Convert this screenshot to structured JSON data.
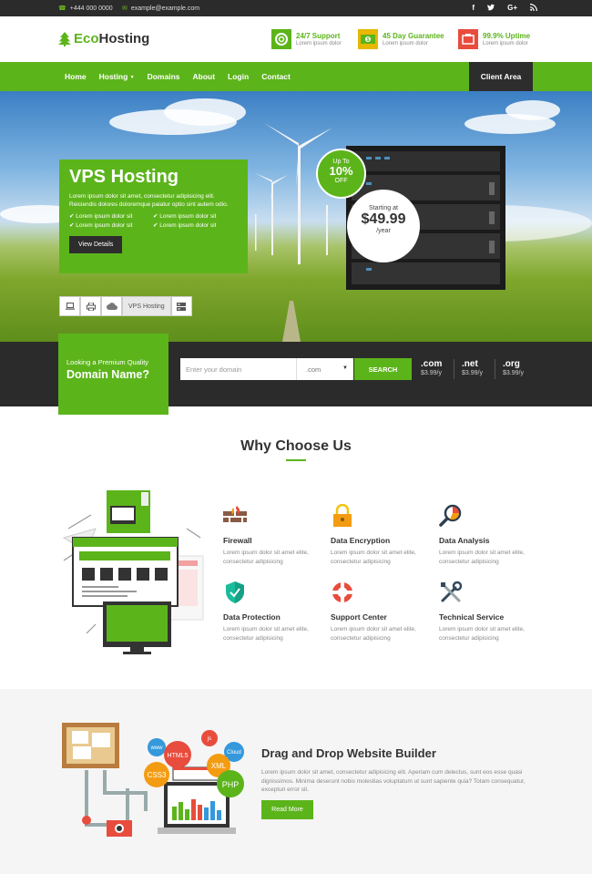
{
  "topbar": {
    "phone": "+444 000 0000",
    "email": "example@example.com",
    "social": [
      "f",
      "t",
      "G+",
      "rss"
    ]
  },
  "header": {
    "logo_part1": "Eco",
    "logo_part2": "Hosting",
    "features": [
      {
        "title": "24/7 Support",
        "sub": "Lorem ipsum dolor",
        "icon": "support-icon",
        "color": "#5cb41b"
      },
      {
        "title": "45 Day Guarantee",
        "sub": "Lorem ipsum dolor",
        "icon": "money-icon",
        "color": "#e6b800"
      },
      {
        "title": "99.9% Uptime",
        "sub": "Lorem ipsum dolor",
        "icon": "uptime-icon",
        "color": "#e84c3d"
      }
    ]
  },
  "nav": {
    "items": [
      "Home",
      "Hosting",
      "Domains",
      "About",
      "Login",
      "Contact"
    ],
    "client_area": "Client Area"
  },
  "hero": {
    "title": "VPS Hosting",
    "text": "Lorem ipsum dolor sit amet, consectetur adipisicing elit. Reiciendis dolores doloremque paiatur optio sint autem odio.",
    "checks": [
      "Lorem ipsum dolor sit",
      "Lorem ipsum dolor sit",
      "Lorem ipsum dolor sit",
      "Lorem ipsum dolor sit"
    ],
    "button": "View Details",
    "promo_top": "Up To",
    "promo_big": "10%",
    "promo_bottom": "OFF",
    "price_label": "Starting at",
    "price_amount": "$49.99",
    "price_unit": "/year",
    "active_tab": "VPS Hosting"
  },
  "domain": {
    "label1": "Looking a Premium Quality",
    "label2": "Domain Name?",
    "placeholder": "Enter your domain",
    "select_value": ".com",
    "search": "SEARCH",
    "tlds": [
      {
        "name": ".com",
        "price": "$3.99/y"
      },
      {
        "name": ".net",
        "price": "$3.99/y"
      },
      {
        "name": ".org",
        "price": "$3.99/y"
      }
    ]
  },
  "why": {
    "title": "Why Choose Us",
    "features": [
      {
        "title": "Firewall",
        "text": "Lorem ipsum dolor sit amet elite, consectetur adipisicing"
      },
      {
        "title": "Data Encryption",
        "text": "Lorem ipsum dolor sit amet elite, consectetur adipisicing"
      },
      {
        "title": "Data Analysis",
        "text": "Lorem ipsum dolor sit amet elite, consectetur adipisicing"
      },
      {
        "title": "Data Protection",
        "text": "Lorem ipsum dolor sit amet elite, consectetur adipisicing"
      },
      {
        "title": "Support Center",
        "text": "Lorem ipsum dolor sit amet elite, consectetur adipisicing"
      },
      {
        "title": "Technical Service",
        "text": "Lorem ipsum dolor sit amet elite, consectetur adipisicing"
      }
    ]
  },
  "builder": {
    "title": "Drag and Drop Website Builder",
    "text": "Lorem ipsum dolor sit amet, consectetur adipisicing elit. Aperiam cum delectus, sunt eos esse quasi dignissimos. Minima deserunt nobis molestias voluptatum ut sunt sapiente quia? Totam consequatur, excepturi error sit.",
    "button": "Read More",
    "tags": [
      "www",
      "HTML5",
      "js",
      "Cloud",
      "CSS3",
      "XML",
      "PHP"
    ]
  }
}
